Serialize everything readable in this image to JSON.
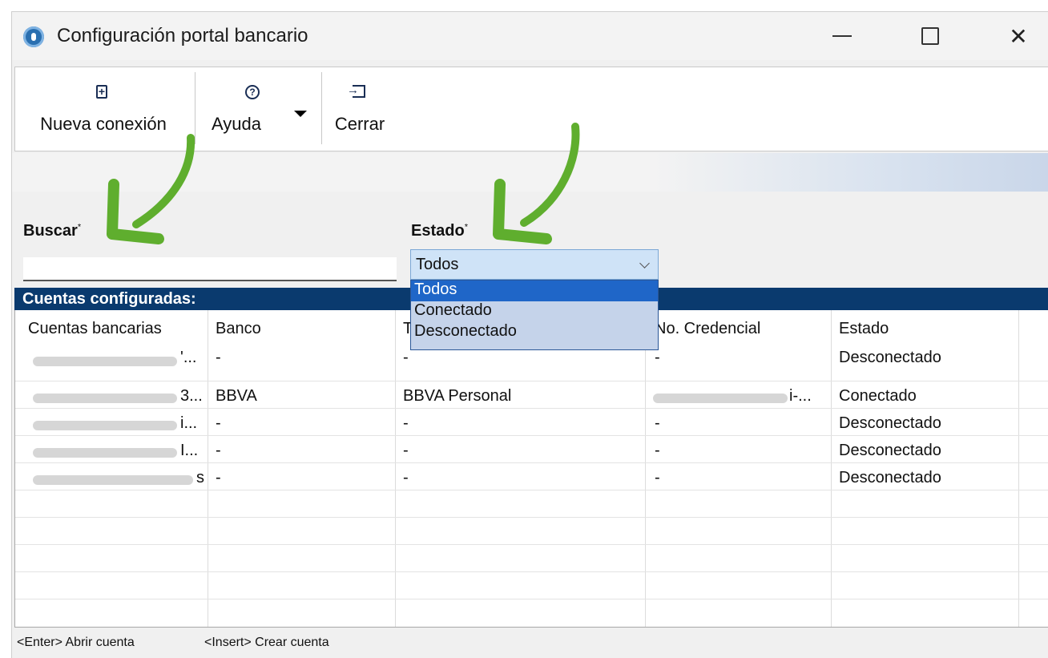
{
  "window": {
    "title": "Configuración portal bancario"
  },
  "toolbar": {
    "new_label": "Nueva conexión",
    "help_label": "Ayuda",
    "close_label": "Cerrar",
    "icons": {
      "new": "file-plus-icon",
      "help": "help-icon",
      "close": "exit-icon"
    }
  },
  "filters": {
    "search_label": "Buscar",
    "status_label": "Estado",
    "required_mark": "*",
    "search_value": "",
    "status_selected": "Todos",
    "status_options": [
      "Todos",
      "Conectado",
      "Desconectado"
    ]
  },
  "section": {
    "title": "Cuentas configuradas:"
  },
  "table": {
    "columns": [
      "Cuentas bancarias",
      "Banco",
      "T",
      "No. Credencial",
      "Estado"
    ],
    "rows": [
      {
        "account_suffix": "'...",
        "bank": "-",
        "type": "-",
        "credential": "-",
        "status": "Desconectado"
      },
      {
        "account_suffix": "3...",
        "bank": "BBVA",
        "type": "BBVA Personal",
        "credential_suffix": "i-...",
        "status": "Conectado"
      },
      {
        "account_suffix": "i...",
        "bank": "-",
        "type": "-",
        "credential": "-",
        "status": "Desconectado"
      },
      {
        "account_suffix": "I...",
        "bank": "-",
        "type": "-",
        "credential": "-",
        "status": "Desconectado"
      },
      {
        "account_suffix": "s",
        "bank": "-",
        "type": "-",
        "credential": "-",
        "status": "Desconectado"
      }
    ]
  },
  "footer": {
    "hint_open": "<Enter> Abrir cuenta",
    "hint_create": "<Insert> Crear cuenta"
  },
  "colors": {
    "section_header": "#0a3a6e",
    "dropdown_highlight": "#1f66c8",
    "annotation_arrow": "#5fae2e"
  }
}
